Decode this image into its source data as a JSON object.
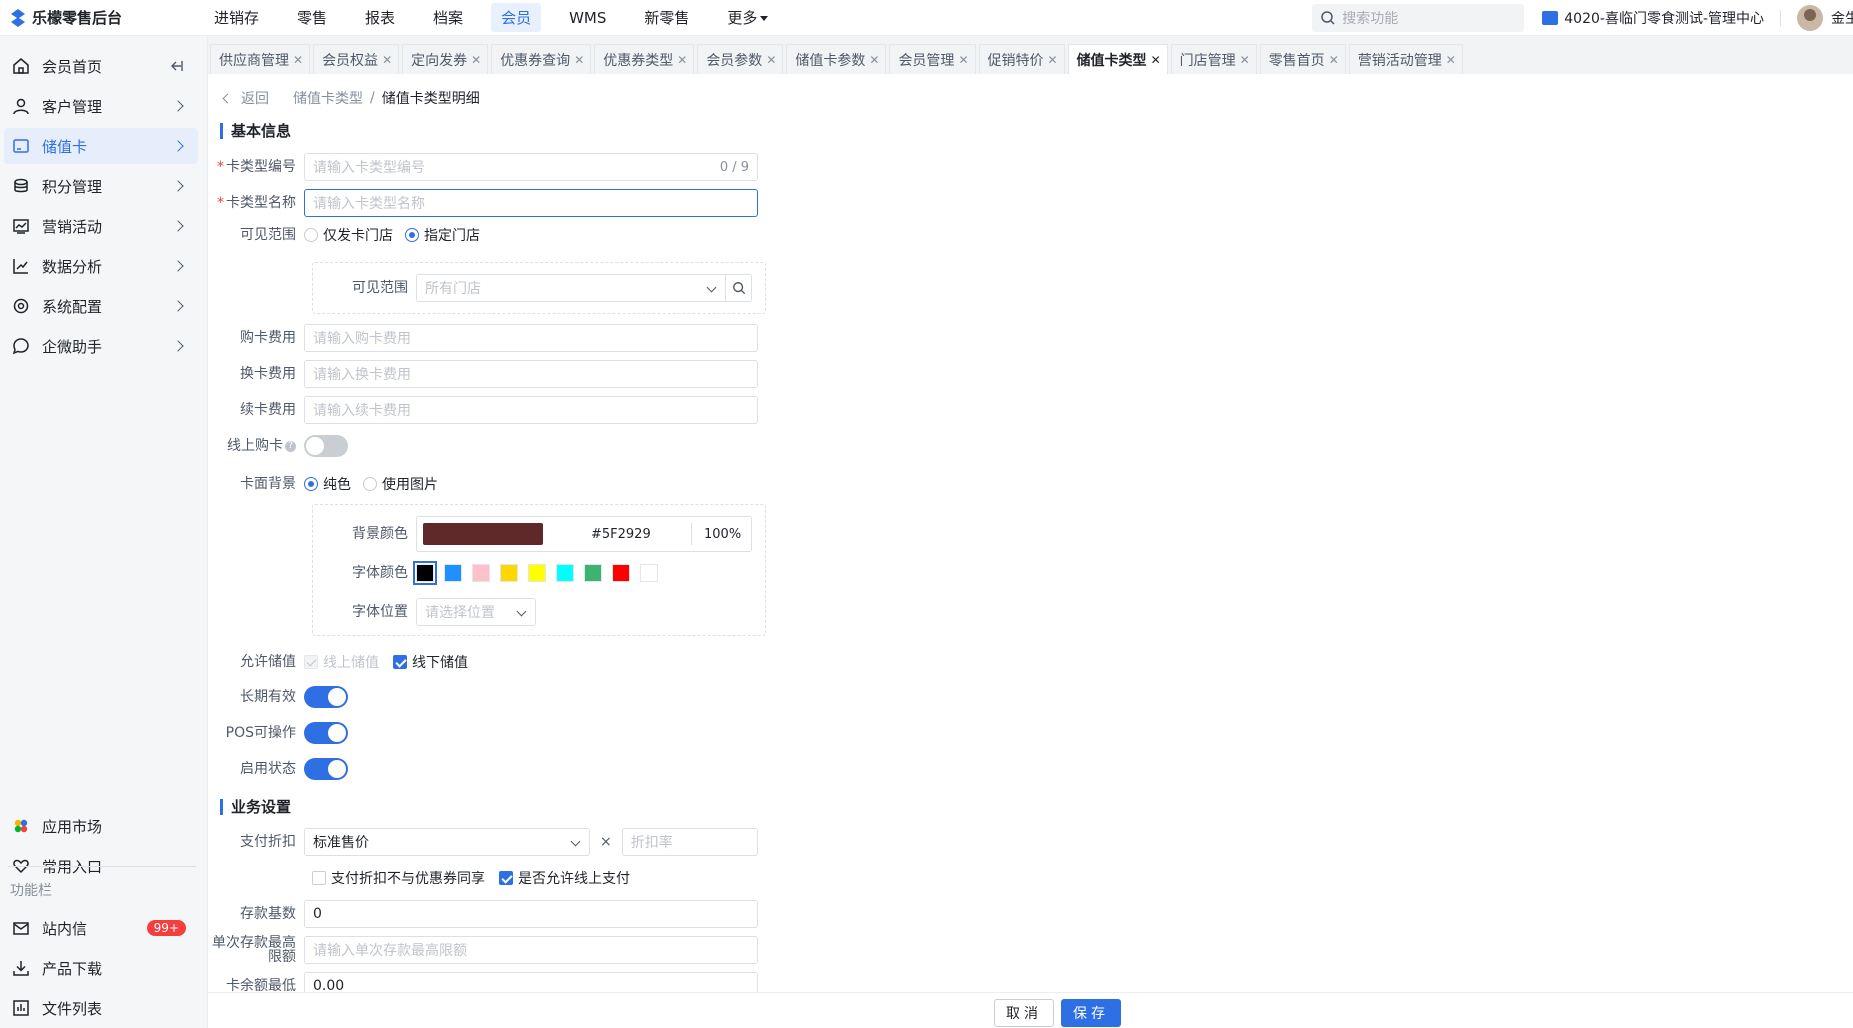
{
  "topbar": {
    "app_title": "乐檬零售后台",
    "nav": [
      "进销存",
      "零售",
      "报表",
      "档案",
      "会员",
      "WMS",
      "新零售",
      "更多"
    ],
    "active_nav": 4,
    "search_placeholder": "搜索功能",
    "store": "4020-喜临门零食测试-管理中心",
    "user": "金生"
  },
  "sidebar": {
    "items": [
      {
        "label": "会员首页",
        "icon": "home-icon"
      },
      {
        "label": "客户管理",
        "icon": "user-icon"
      },
      {
        "label": "储值卡",
        "icon": "card-icon"
      },
      {
        "label": "积分管理",
        "icon": "coins-icon"
      },
      {
        "label": "营销活动",
        "icon": "chart-icon"
      },
      {
        "label": "数据分析",
        "icon": "trend-icon"
      },
      {
        "label": "系统配置",
        "icon": "settings-icon"
      },
      {
        "label": "企微助手",
        "icon": "chat-icon"
      }
    ],
    "active_index": 2,
    "bottom": {
      "app_market": "应用市场",
      "common_entry": "常用入口",
      "func_bar": "功能栏",
      "inbox": "站内信",
      "inbox_badge": "99+",
      "download": "产品下载",
      "files": "文件列表"
    }
  },
  "tabs": [
    "供应商管理",
    "会员权益",
    "定向发券",
    "优惠券查询",
    "优惠券类型",
    "会员参数",
    "储值卡参数",
    "会员管理",
    "促销特价",
    "储值卡类型",
    "门店管理",
    "零售首页",
    "营销活动管理"
  ],
  "active_tab": 9,
  "breadcrumb": {
    "back": "返回",
    "parent": "储值卡类型",
    "current": "储值卡类型明细"
  },
  "basic": {
    "title": "基本信息",
    "card_code_label": "卡类型编号",
    "card_code_placeholder": "请输入卡类型编号",
    "card_code_counter": "0 / 9",
    "card_name_label": "卡类型名称",
    "card_name_placeholder": "请输入卡类型名称",
    "scope_label": "可见范围",
    "scope_opt1": "仅发卡门店",
    "scope_opt2": "指定门店",
    "scope_inner_label": "可见范围",
    "scope_inner_placeholder": "所有门店",
    "buy_fee_label": "购卡费用",
    "buy_fee_placeholder": "请输入购卡费用",
    "change_fee_label": "换卡费用",
    "change_fee_placeholder": "请输入换卡费用",
    "renew_fee_label": "续卡费用",
    "renew_fee_placeholder": "请输入续卡费用",
    "online_buy_label": "线上购卡",
    "bg_label": "卡面背景",
    "bg_opt1": "纯色",
    "bg_opt2": "使用图片",
    "bg_color_label": "背景颜色",
    "bg_color_hex": "#5F2929",
    "bg_color_pct": "100%",
    "font_color_label": "字体颜色",
    "font_colors": [
      "#000000",
      "#1e90ff",
      "#ffc0cb",
      "#ffd700",
      "#ffff00",
      "#00ffff",
      "#3cb371",
      "#ff0000",
      "#ffffff"
    ],
    "font_pos_label": "字体位置",
    "font_pos_placeholder": "请选择位置",
    "allow_deposit_label": "允许储值",
    "deposit_online": "线上储值",
    "deposit_offline": "线下储值",
    "long_valid_label": "长期有效",
    "pos_label": "POS可操作",
    "enable_label": "启用状态"
  },
  "biz": {
    "title": "业务设置",
    "discount_label": "支付折扣",
    "discount_value": "标准售价",
    "discount_rate_placeholder": "折扣率",
    "times": "×",
    "chk1": "支付折扣不与优惠券同享",
    "chk2": "是否允许线上支付",
    "deposit_base_label": "存款基数",
    "deposit_base_value": "0",
    "max_deposit_label": "单次存款最高限额",
    "max_deposit_placeholder": "请输入单次存款最高限额",
    "min_balance_label": "卡余额最低",
    "min_balance_value": "0.00"
  },
  "footer": {
    "cancel": "取消",
    "save": "保存"
  }
}
